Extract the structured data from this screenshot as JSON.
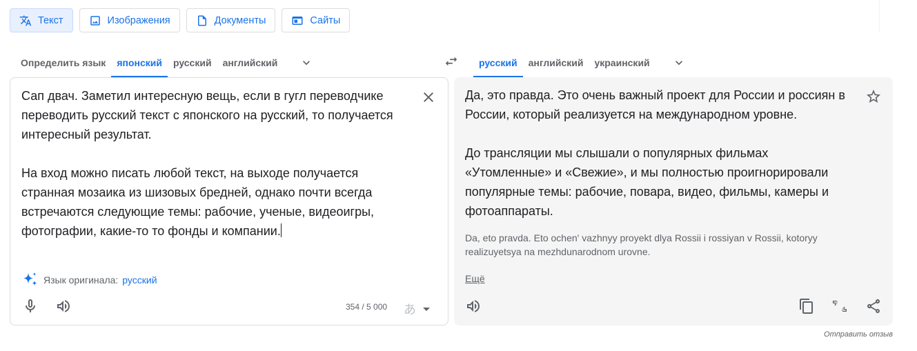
{
  "modes": [
    {
      "label": "Текст",
      "icon": "translate-icon",
      "active": true
    },
    {
      "label": "Изображения",
      "icon": "image-icon",
      "active": false
    },
    {
      "label": "Документы",
      "icon": "document-icon",
      "active": false
    },
    {
      "label": "Сайты",
      "icon": "website-icon",
      "active": false
    }
  ],
  "source": {
    "langs": [
      "Определить язык",
      "японский",
      "русский",
      "английский"
    ],
    "active_lang": "японский",
    "text": "Сап двач. Заметил интересную вещь, если в гугл переводчике переводить русский текст с японского на русский, то получается интересный результат.\n\nНа вход можно писать любой текст, на выходе получается странная мозаика из шизовых бредней, однако почти всегда встречаются следующие темы: рабочие, ученые, видеоигры, фотографии, какие-то то фонды и компании.",
    "detected_label": "Язык оригинала:",
    "detected_lang": "русский",
    "counter": "354 / 5 000",
    "ime_glyph": "あ"
  },
  "target": {
    "langs": [
      "русский",
      "английский",
      "украинский"
    ],
    "active_lang": "русский",
    "text": "Да, это правда. Это очень важный проект для России и россиян в России, который реализуется на международном уровне.\n\nДо трансляции мы слышали о популярных фильмах «Утомленные» и «Свежие», и мы полностью проигнорировали популярные темы: рабочие, повара, видео, фильмы, камеры и фотоаппараты.",
    "transliteration": "Da, eto pravda. Eto ochen' vazhnyy proyekt dlya Rossii i rossiyan v Rossii, kotoryy realizuyetsya na mezhdunarodnom urovne.",
    "more_label": "Ещё"
  },
  "feedback": "Отправить отзыв",
  "colors": {
    "accent": "#1a73e8",
    "muted": "#5f6368",
    "panel": "#f5f5f5"
  }
}
